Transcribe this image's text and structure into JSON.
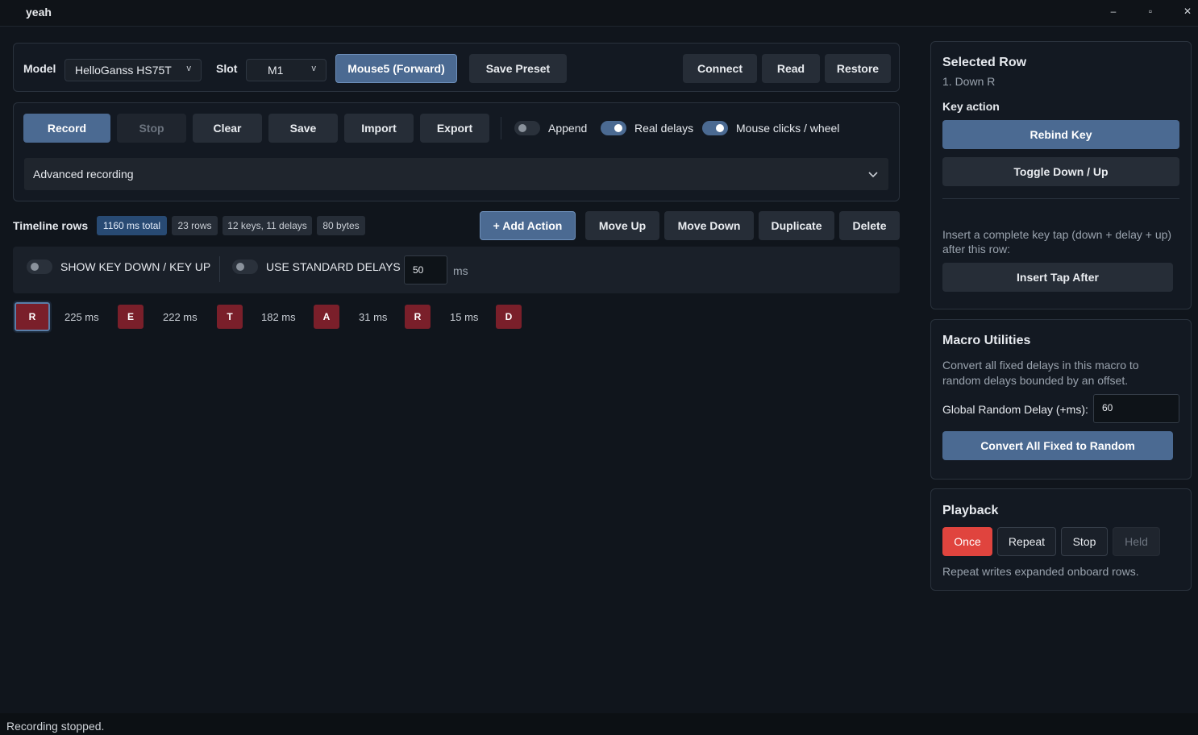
{
  "window": {
    "title": "yeah",
    "minimize": "‒",
    "maximize": "▫",
    "close": "✕"
  },
  "device_bar": {
    "model_label": "Model",
    "model_value": "HelloGanss HS75T",
    "slot_label": "Slot",
    "slot_value": "M1",
    "caret": "v",
    "mouse_button": "Mouse5 (Forward)",
    "save_preset": "Save Preset",
    "connect": "Connect",
    "read": "Read",
    "restore": "Restore"
  },
  "record_bar": {
    "record": "Record",
    "stop": "Stop",
    "clear": "Clear",
    "save": "Save",
    "import": "Import",
    "export": "Export",
    "append_label": "Append",
    "real_delays_label": "Real delays",
    "mouse_label": "Mouse clicks / wheel",
    "append_on": false,
    "real_delays_on": true,
    "mouse_on": true,
    "advanced_label": "Advanced recording"
  },
  "timeline": {
    "label": "Timeline rows",
    "stats": [
      "1160 ms total",
      "23 rows",
      "12 keys, 11 delays",
      "80 bytes"
    ],
    "add_action": "+ Add Action",
    "move_up": "Move Up",
    "move_down": "Move Down",
    "duplicate": "Duplicate",
    "delete": "Delete",
    "show_key_label": "SHOW KEY DOWN / KEY UP",
    "std_delays_label": "USE STANDARD DELAYS",
    "std_delay_value": "50",
    "ms": "ms",
    "sequence": [
      {
        "key": "R",
        "delay": "225 ms"
      },
      {
        "key": "E",
        "delay": "222 ms"
      },
      {
        "key": "T",
        "delay": "182 ms"
      },
      {
        "key": "A",
        "delay": "31 ms"
      },
      {
        "key": "R",
        "delay": "15 ms"
      },
      {
        "key": "D",
        "delay": ""
      }
    ]
  },
  "selected_row": {
    "title": "Selected Row",
    "subtitle": "1. Down R",
    "key_action": "Key action",
    "rebind": "Rebind Key",
    "toggle": "Toggle Down / Up",
    "insert_desc": "Insert a complete key tap (down + delay + up) after this row:",
    "insert_btn": "Insert Tap After"
  },
  "macro_utils": {
    "title": "Macro Utilities",
    "desc": "Convert all fixed delays in this macro to random delays bounded by an offset.",
    "random_label": "Global Random Delay (+ms):",
    "random_value": "60",
    "convert_btn": "Convert All Fixed to Random"
  },
  "playback": {
    "title": "Playback",
    "once": "Once",
    "repeat": "Repeat",
    "stop": "Stop",
    "held": "Held",
    "note": "Repeat writes expanded onboard rows."
  },
  "status": "Recording stopped."
}
